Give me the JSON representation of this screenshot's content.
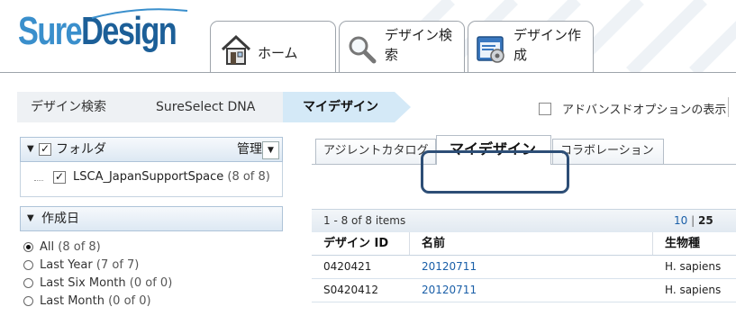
{
  "app": {
    "logo": {
      "part1": "Sure",
      "part2": "Design"
    }
  },
  "nav_tabs": [
    {
      "label": "ホーム",
      "icon": "home-icon"
    },
    {
      "label": "デザイン検索",
      "line1": "デザイン検",
      "line2": "索",
      "icon": "magnifier-icon"
    },
    {
      "label": "デザイン作成",
      "line1": "デザイン作",
      "line2": "成",
      "icon": "design-create-icon"
    }
  ],
  "breadcrumb": [
    {
      "label": "デザイン検索"
    },
    {
      "label": "SureSelect DNA"
    },
    {
      "label": "マイデザイン"
    }
  ],
  "advanced_options": {
    "label": "アドバンスドオプションの表示",
    "checked": false
  },
  "sidebar": {
    "folder_panel": {
      "title": "フォルダ",
      "manage_label": "管理",
      "items": [
        {
          "name": "LSCA_JapanSupportSpace",
          "count": "(8 of 8)",
          "checked": true
        }
      ]
    },
    "date_panel": {
      "title": "作成日",
      "options": [
        {
          "label": "All",
          "count": "(8 of 8)",
          "selected": true
        },
        {
          "label": "Last Year",
          "count": "(7 of 7)",
          "selected": false
        },
        {
          "label": "Last Six Month",
          "count": "(0 of 0)",
          "selected": false
        },
        {
          "label": "Last Month",
          "count": "(0 of 0)",
          "selected": false
        }
      ]
    }
  },
  "content_tabs": [
    {
      "label": "アジレントカタログ",
      "active": false
    },
    {
      "label": "マイデザイン",
      "active": true
    },
    {
      "label": "コラボレーション",
      "active": false
    }
  ],
  "table": {
    "pager_text": "1 - 8 of 8 items",
    "page_size_10": "10",
    "page_size_sep": "|",
    "page_size_25": "25",
    "columns": [
      "デザイン ID",
      "名前",
      "生物種"
    ],
    "rows": [
      {
        "id": "0420421",
        "name": "20120711",
        "organism": "H. sapiens"
      },
      {
        "id": "S0420412",
        "name": "20120711",
        "organism": "H. sapiens"
      }
    ]
  },
  "colors": {
    "logo_light": "#3a8fcc",
    "logo_dark": "#1c5f98",
    "link": "#1a5fa8",
    "highlight_border": "#2d4e76",
    "active_crumb": "#d4e9f7"
  }
}
